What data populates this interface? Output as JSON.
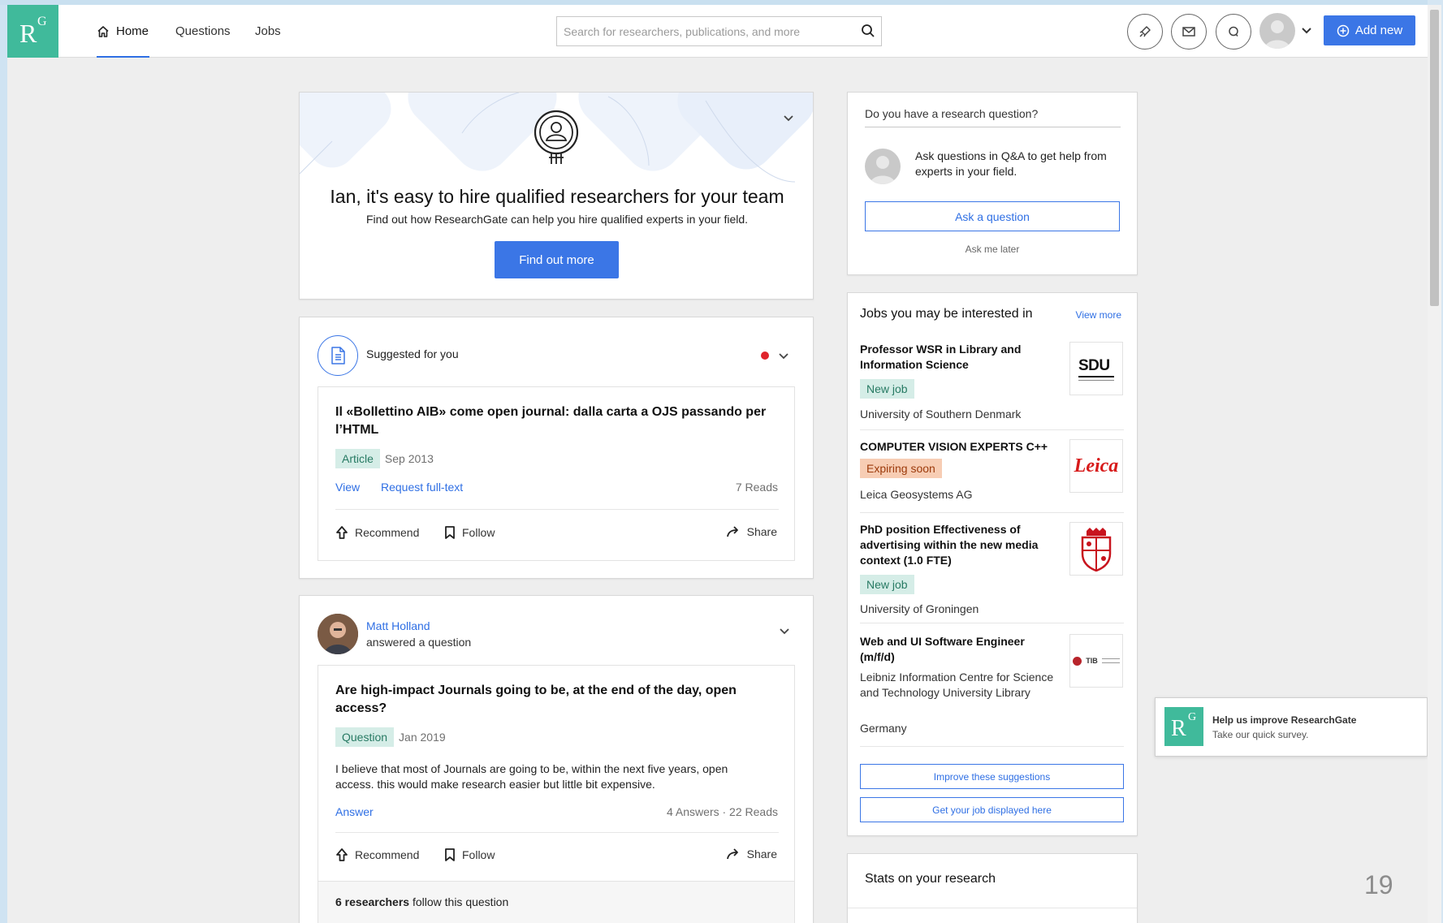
{
  "nav": {
    "logo_r": "R",
    "logo_g": "G",
    "home": "Home",
    "questions": "Questions",
    "jobs": "Jobs",
    "search_placeholder": "Search for researchers, publications, and more",
    "add_new": "Add new"
  },
  "hire_card": {
    "title": "Ian, it's easy to hire qualified researchers for your team",
    "subtitle": "Find out how ResearchGate can help you hire qualified experts in your field.",
    "cta": "Find out more"
  },
  "suggested": {
    "header": "Suggested for you",
    "title": "Il «Bollettino AIB» come open journal: dalla carta a OJS passando per l’HTML",
    "tag": "Article",
    "date": "Sep 2013",
    "view": "View",
    "request": "Request full-text",
    "reads": "7 Reads",
    "recommend": "Recommend",
    "follow": "Follow",
    "share": "Share"
  },
  "question_post": {
    "author": "Matt Holland",
    "action": "answered a question",
    "title": "Are high-impact Journals going to be, at the end of the day, open access?",
    "tag": "Question",
    "date": "Jan 2019",
    "body": "I believe that most of Journals are going to be, within the next five years, open access. this would make research easier but little bit expensive.",
    "answer": "Answer",
    "stats": "4 Answers · 22 Reads",
    "recommend": "Recommend",
    "follow": "Follow",
    "share": "Share",
    "followers_bold": "6 researchers",
    "followers_rest": " follow this question"
  },
  "ask_card": {
    "prompt": "Do you have a research question?",
    "text": "Ask questions in Q&A to get help from experts in your field.",
    "button": "Ask a question",
    "later": "Ask me later"
  },
  "jobs_card": {
    "title": "Jobs you may be interested in",
    "view_more": "View more",
    "jobs": [
      {
        "title": "Professor WSR in Library and Information Science",
        "badge": "New job",
        "org": "University of Southern Denmark",
        "logo": "SDU"
      },
      {
        "title": "COMPUTER VISION EXPERTS C++",
        "badge": "Expiring soon",
        "org": "Leica Geosystems AG",
        "logo": "Leica"
      },
      {
        "title": "PhD position Effectiveness of advertising within the new media context (1.0 FTE)",
        "badge": "New job",
        "org": "University of Groningen",
        "logo": ""
      },
      {
        "title": "Web and UI Software Engineer (m/f/d)",
        "org": "Leibniz Information Centre for Science and Technology University Library",
        "country": "Germany",
        "logo": "TIB"
      }
    ],
    "improve": "Improve these suggestions",
    "display": "Get your job displayed here"
  },
  "stats_card": {
    "title": "Stats on your research"
  },
  "survey": {
    "title": "Help us improve ResearchGate",
    "subtitle": "Take our quick survey."
  },
  "slide_number": "19",
  "colors": {
    "brand": "#40ba9b",
    "primary": "#3b76e6",
    "tag_green": "#d5ede7",
    "tag_orange": "#f7cdb4"
  }
}
